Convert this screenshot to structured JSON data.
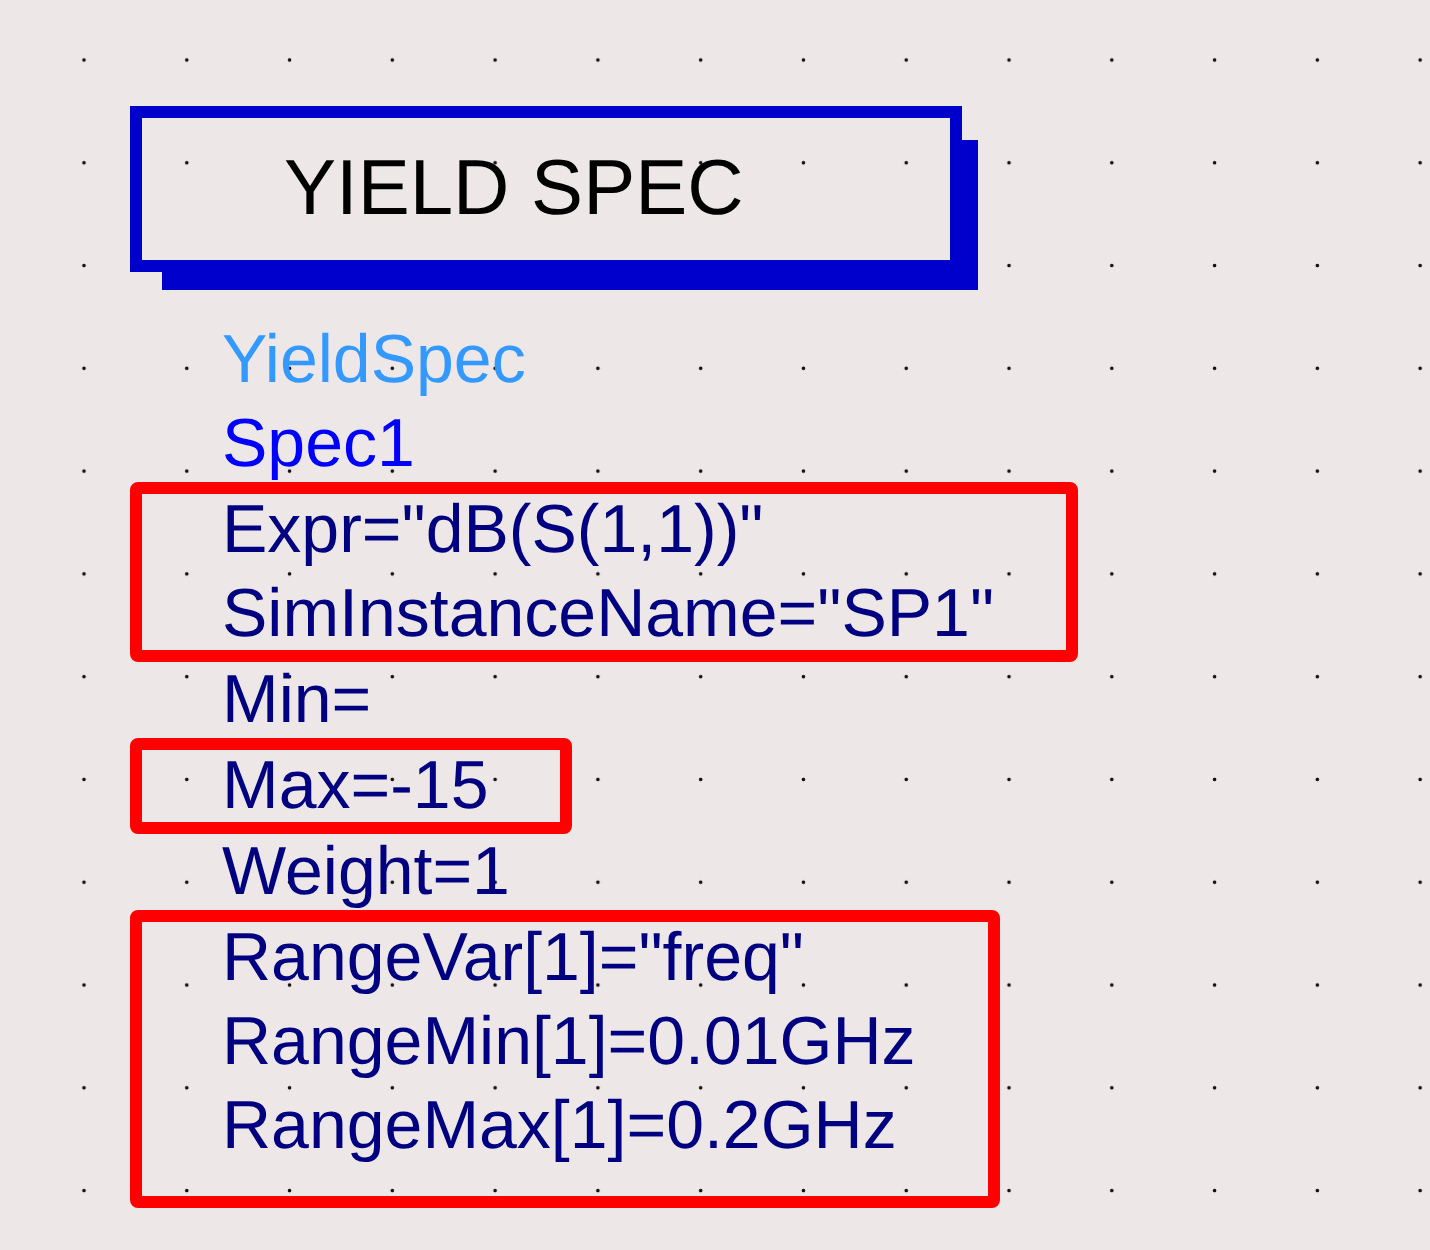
{
  "symbol": {
    "title": "YIELD SPEC"
  },
  "label_groups": [
    {
      "highlighted": false,
      "lines": [
        {
          "kind": "model",
          "text": "YieldSpec"
        },
        {
          "kind": "instance",
          "text": "Spec1"
        }
      ]
    },
    {
      "highlighted": true,
      "lines": [
        {
          "kind": "parameter",
          "text": "Expr=\"dB(S(1,1))\""
        },
        {
          "kind": "parameter",
          "text": "SimInstanceName=\"SP1\""
        }
      ]
    },
    {
      "highlighted": false,
      "lines": [
        {
          "kind": "parameter",
          "text": "Min="
        }
      ]
    },
    {
      "highlighted": true,
      "lines": [
        {
          "kind": "parameter",
          "text": "Max=-15"
        }
      ]
    },
    {
      "highlighted": false,
      "lines": [
        {
          "kind": "parameter",
          "text": "Weight=1"
        }
      ]
    },
    {
      "highlighted": true,
      "lines": [
        {
          "kind": "parameter",
          "text": "RangeVar[1]=\"freq\""
        },
        {
          "kind": "parameter",
          "text": "RangeMin[1]=0.01GHz"
        },
        {
          "kind": "parameter",
          "text": "RangeMax[1]=0.2GHz"
        }
      ]
    }
  ]
}
